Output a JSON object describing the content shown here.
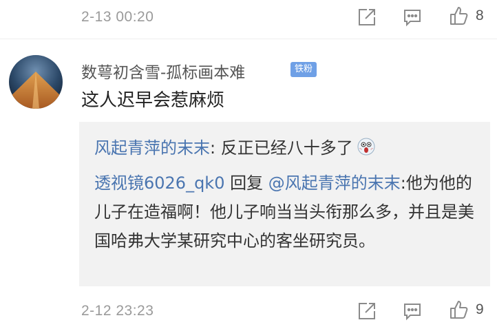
{
  "top_item": {
    "timestamp": "2-13 00:20",
    "like_count": "8",
    "icons": [
      "share-icon",
      "comment-icon",
      "thumbs-up-icon"
    ]
  },
  "comment": {
    "username": "数萼初含雪-孤标画本难",
    "badge": "铁粉",
    "text": "这人迟早会惹麻烦",
    "quote": {
      "author": "风起青萍的末末",
      "author_sep": ":",
      "text": " 反正已经八十多了",
      "emoji_icon": "scream-face-icon",
      "reply_user": "透视镜6026_qk0",
      "reply_word": " 回复 ",
      "reply_to": "@风起青萍的末末",
      "reply_sep": ":",
      "reply_text": "他为他的儿子在造福啊！他儿子响当当头衔那么多，并且是美国哈弗大学某研究中心的客坐研究员。"
    },
    "timestamp": "2-12 23:23",
    "like_count": "9"
  },
  "colors": {
    "link": "#4a75b0",
    "badge": "#6fa0e6",
    "quote_bg": "#f2f2f2"
  }
}
